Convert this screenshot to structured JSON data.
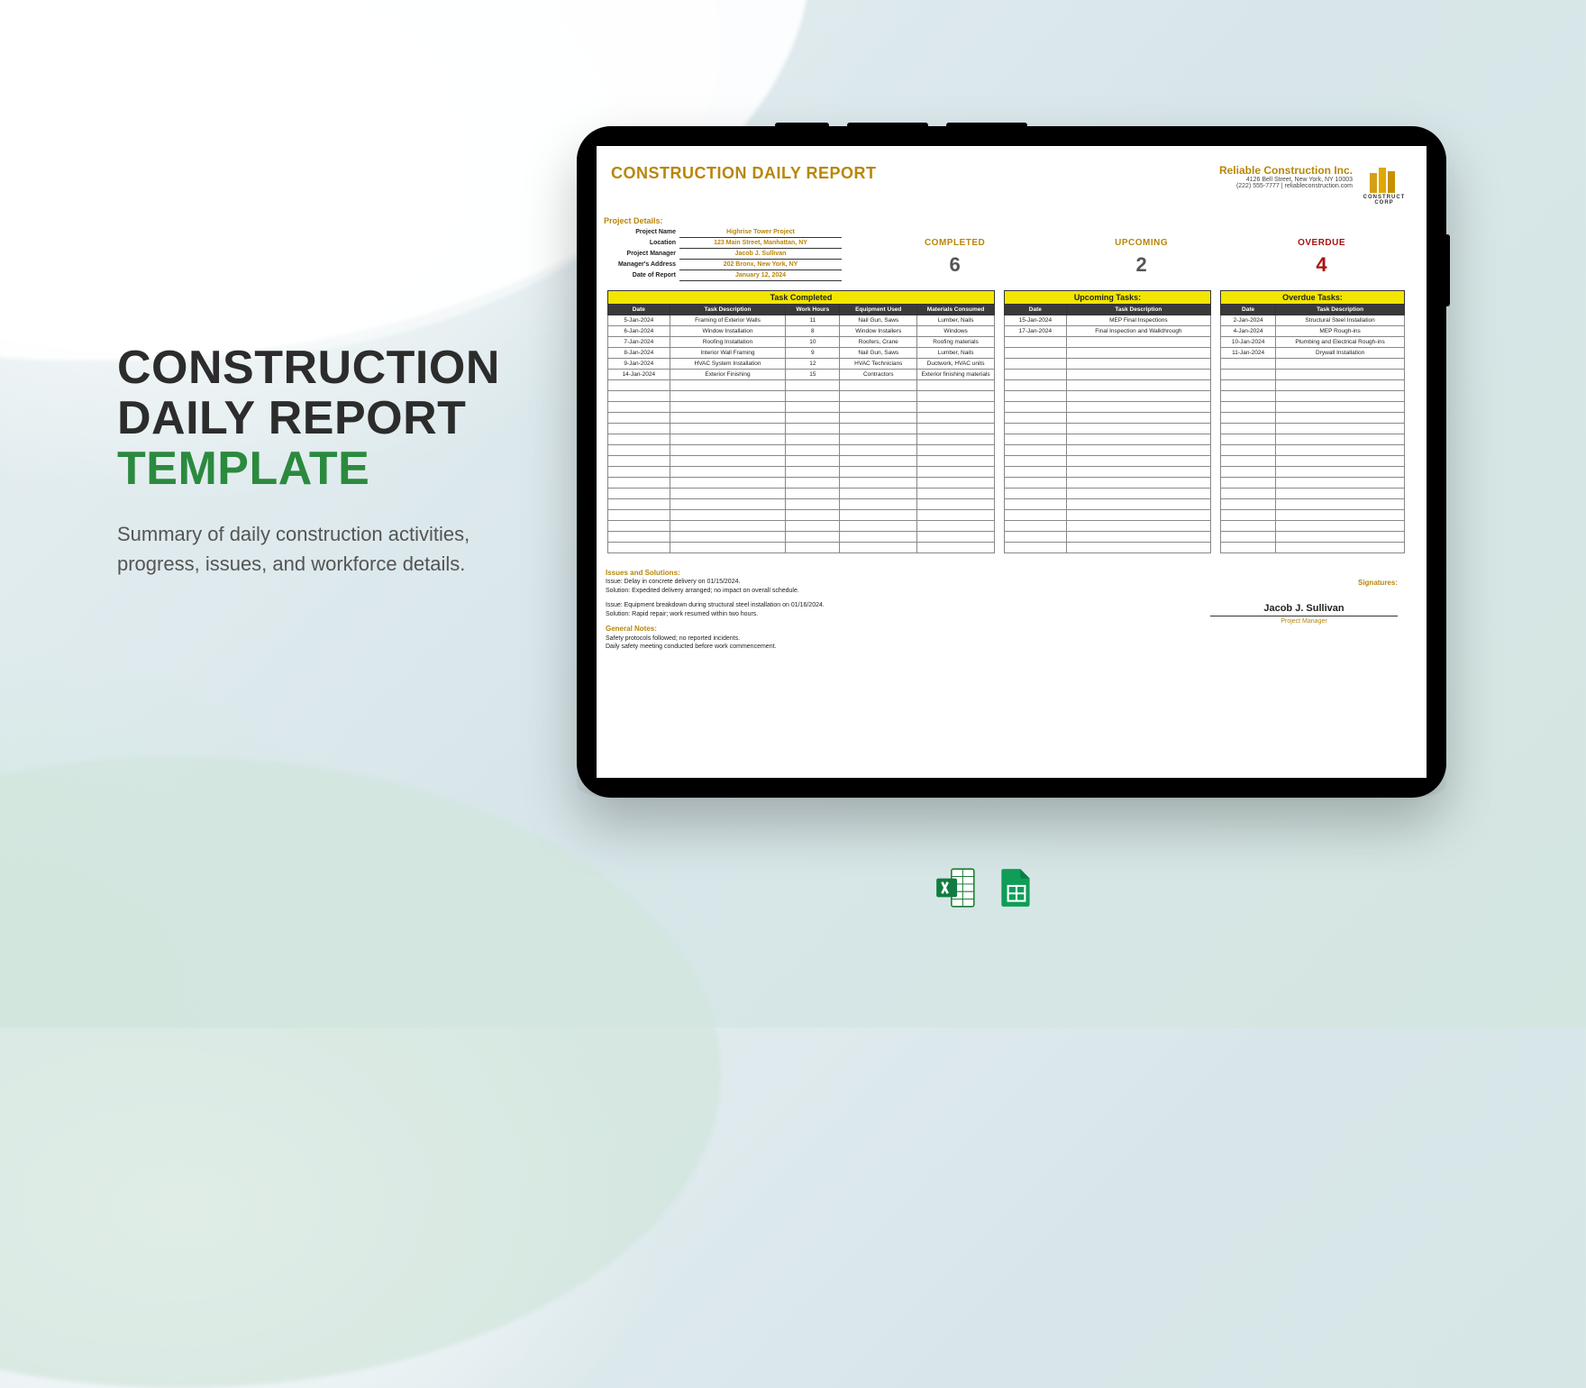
{
  "marketing": {
    "title_line1": "CONSTRUCTION",
    "title_line2": "DAILY REPORT",
    "title_line3": "TEMPLATE",
    "subtitle": "Summary of daily construction activities, progress, issues, and workforce details."
  },
  "report": {
    "title": "CONSTRUCTION DAILY REPORT",
    "company": {
      "name": "Reliable Construction Inc.",
      "address": "4126 Bell Street, New York, NY 10003",
      "contact": "(222) 555-7777 | reliableconstruction.com",
      "logo_label": "CONSTRUCT CORP"
    },
    "project_details_label": "Project Details:",
    "project": {
      "name_k": "Project Name",
      "name_v": "Highrise Tower Project",
      "location_k": "Location",
      "location_v": "123 Main Street, Manhattan, NY",
      "manager_k": "Project Manager",
      "manager_v": "Jacob J. Sullivan",
      "maddr_k": "Manager's Address",
      "maddr_v": "202 Bronx, New York, NY",
      "date_k": "Date of Report",
      "date_v": "January 12, 2024"
    },
    "stats": {
      "completed_label": "COMPLETED",
      "completed_value": "6",
      "upcoming_label": "UPCOMING",
      "upcoming_value": "2",
      "overdue_label": "OVERDUE",
      "overdue_value": "4"
    },
    "tables": {
      "completed": {
        "title": "Task Completed",
        "headers": [
          "Date",
          "Task Description",
          "Work Hours",
          "Equipment Used",
          "Materials Consumed"
        ],
        "rows": [
          [
            "5-Jan-2024",
            "Framing of Exterior Walls",
            "11",
            "Nail Gun, Saws",
            "Lumber, Nails"
          ],
          [
            "6-Jan-2024",
            "Window Installation",
            "8",
            "Window Installers",
            "Windows"
          ],
          [
            "7-Jan-2024",
            "Roofing Installation",
            "10",
            "Roofers, Crane",
            "Roofing materials"
          ],
          [
            "8-Jan-2024",
            "Interior Wall Framing",
            "9",
            "Nail Gun, Saws",
            "Lumber, Nails"
          ],
          [
            "9-Jan-2024",
            "HVAC System Installation",
            "12",
            "HVAC Technicians",
            "Ductwork, HVAC units"
          ],
          [
            "14-Jan-2024",
            "Exterior Finishing",
            "15",
            "Contractors",
            "Exterior finishing materials"
          ]
        ]
      },
      "upcoming": {
        "title": "Upcoming Tasks:",
        "headers": [
          "Date",
          "Task Description"
        ],
        "rows": [
          [
            "15-Jan-2024",
            "MEP Final Inspections"
          ],
          [
            "17-Jan-2024",
            "Final Inspection and Walkthrough"
          ]
        ]
      },
      "overdue": {
        "title": "Overdue Tasks:",
        "headers": [
          "Date",
          "Task Description"
        ],
        "rows": [
          [
            "2-Jan-2024",
            "Structural Steel Installation"
          ],
          [
            "4-Jan-2024",
            "MEP Rough-ins"
          ],
          [
            "10-Jan-2024",
            "Plumbing and Electrical Rough-ins"
          ],
          [
            "11-Jan-2024",
            "Drywall Installation"
          ]
        ]
      }
    },
    "issues": {
      "header": "Issues and Solutions:",
      "l1": "Issue: Delay in concrete delivery on 01/15/2024.",
      "l2": "Solution: Expedited delivery arranged; no impact on overall schedule.",
      "l3": "Issue: Equipment breakdown during structural steel installation on 01/16/2024.",
      "l4": "Solution: Rapid repair; work resumed within two hours."
    },
    "general": {
      "header": "General Notes:",
      "l1": "Safety protocols followed; no reported incidents.",
      "l2": "Daily safety meeting conducted before work commencement."
    },
    "signature": {
      "header": "Signatures:",
      "name": "Jacob J. Sullivan",
      "role": "Project Manager"
    }
  },
  "icons": {
    "excel": "excel-icon",
    "sheets": "google-sheets-icon"
  }
}
